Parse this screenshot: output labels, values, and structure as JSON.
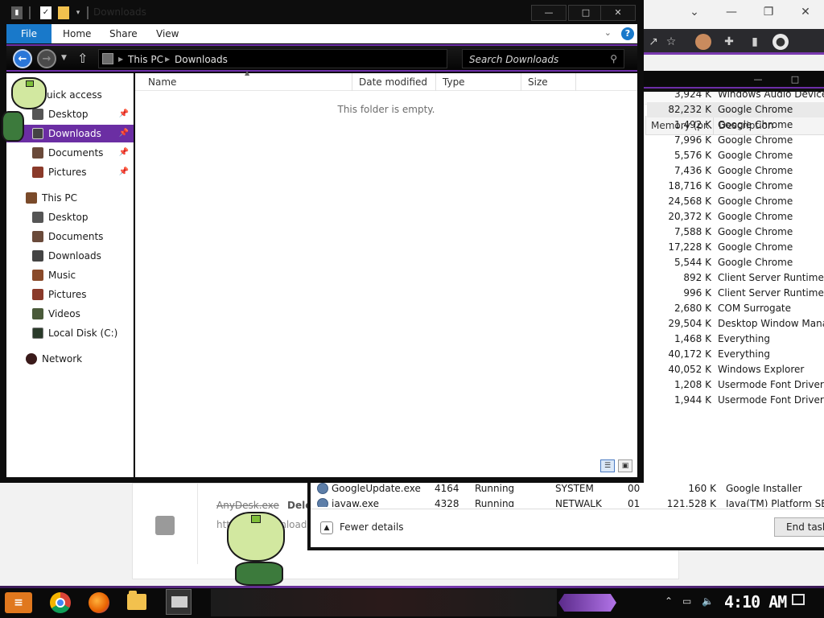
{
  "explorer": {
    "title": "Downloads",
    "ribbon_tabs": [
      "File",
      "Home",
      "Share",
      "View"
    ],
    "breadcrumb": [
      "This PC",
      "Downloads"
    ],
    "search_placeholder": "Search Downloads",
    "columns": [
      "Name",
      "Date modified",
      "Type",
      "Size"
    ],
    "empty_message": "This folder is empty.",
    "quick_access_label": "uick access",
    "quick_access": [
      {
        "label": "Desktop",
        "pinned": true
      },
      {
        "label": "Downloads",
        "pinned": true,
        "selected": true
      },
      {
        "label": "Documents",
        "pinned": true
      },
      {
        "label": "Pictures",
        "pinned": true
      }
    ],
    "this_pc_label": "This PC",
    "this_pc": [
      "Desktop",
      "Documents",
      "Downloads",
      "Music",
      "Pictures",
      "Videos",
      "Local Disk (C:)"
    ],
    "network_label": "Network"
  },
  "taskmgr": {
    "columns": {
      "memory": "Memory (pr...",
      "description": "Description"
    },
    "rows": [
      {
        "memory": "3,924 K",
        "description": "Windows Audio Device ..."
      },
      {
        "memory": "82,232 K",
        "description": "Google Chrome",
        "selected": true
      },
      {
        "memory": "1,492 K",
        "description": "Google Chrome"
      },
      {
        "memory": "7,996 K",
        "description": "Google Chrome"
      },
      {
        "memory": "5,576 K",
        "description": "Google Chrome"
      },
      {
        "memory": "7,436 K",
        "description": "Google Chrome"
      },
      {
        "memory": "18,716 K",
        "description": "Google Chrome"
      },
      {
        "memory": "24,568 K",
        "description": "Google Chrome"
      },
      {
        "memory": "20,372 K",
        "description": "Google Chrome"
      },
      {
        "memory": "7,588 K",
        "description": "Google Chrome"
      },
      {
        "memory": "17,228 K",
        "description": "Google Chrome"
      },
      {
        "memory": "5,544 K",
        "description": "Google Chrome"
      },
      {
        "memory": "892 K",
        "description": "Client Server Runtime Pr..."
      },
      {
        "memory": "996 K",
        "description": "Client Server Runtime Pr..."
      },
      {
        "memory": "2,680 K",
        "description": "COM Surrogate"
      },
      {
        "memory": "29,504 K",
        "description": "Desktop Window Manager"
      },
      {
        "memory": "1,468 K",
        "description": "Everything"
      },
      {
        "memory": "40,172 K",
        "description": "Everything"
      },
      {
        "memory": "40,052 K",
        "description": "Windows Explorer"
      },
      {
        "memory": "1,208 K",
        "description": "Usermode Font Driver Host"
      },
      {
        "memory": "1,944 K",
        "description": "Usermode Font Driver Host"
      }
    ],
    "bottom_rows": [
      {
        "name": "GoogleUpdate.exe",
        "pid": "4164",
        "status": "Running",
        "user": "SYSTEM",
        "cpu": "00",
        "memory": "160 K",
        "description": "Google Installer"
      },
      {
        "name": "javaw.exe",
        "pid": "4328",
        "status": "Running",
        "user": "NETWALK",
        "cpu": "01",
        "memory": "121,528 K",
        "description": "Java(TM) Platform SE bi..."
      }
    ],
    "fewer_details": "Fewer details",
    "end_task": "End task"
  },
  "background_page": {
    "file_name": "AnyDesk.exe",
    "action": "Dele",
    "url_fragment": "https://...download.an"
  },
  "taskbar": {
    "clock": "4:10 AM"
  },
  "colors": {
    "accent_purple": "#6b2ea3",
    "file_tab_blue": "#1979ca"
  }
}
